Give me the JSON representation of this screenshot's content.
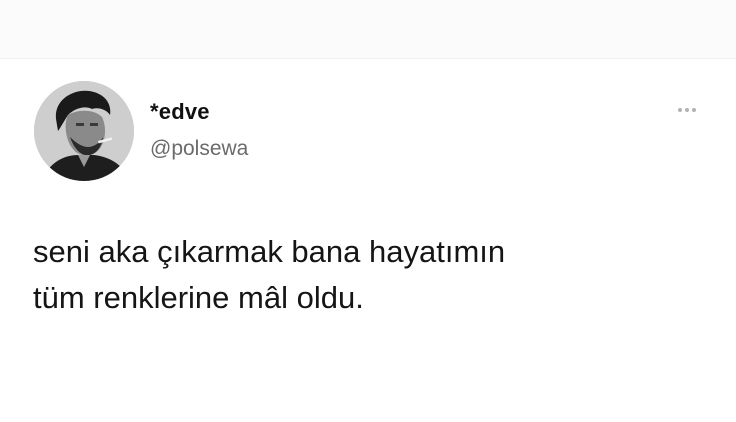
{
  "tweet": {
    "display_name": "*edve",
    "handle": "@polsewa",
    "text_lines": [
      "seni aka çıkarmak bana hayatımın",
      "tüm renklerine mâl oldu."
    ],
    "avatar_icon": "profile-photo",
    "more_icon": "more-horizontal-icon"
  },
  "colors": {
    "background": "#ffffff",
    "name_text": "#111111",
    "handle_text": "#6b6b6b",
    "body_text": "#151515",
    "more_dots": "#b3b3b3"
  }
}
